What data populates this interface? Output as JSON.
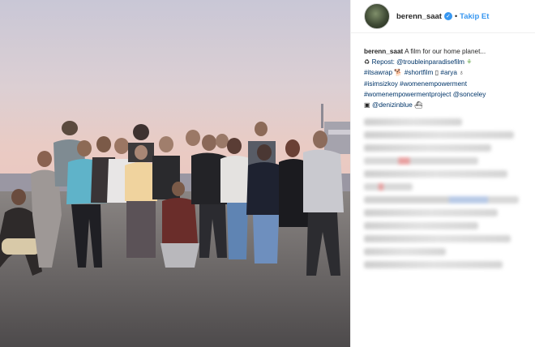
{
  "post": {
    "username": "berenn_saat",
    "follow_label": "Takip Et",
    "separator": "•",
    "caption": {
      "username": "berenn_saat",
      "text": "A film for our home planet...",
      "line2": "Repost: @troubleinparadisefilm",
      "line3a": "#itsawrap",
      "line3b": "#shortfilm",
      "line3c": "#arya",
      "line4a": "#isimsizkoy",
      "line4b": "#womenempowerment",
      "line5a": "#womenempowermentproject",
      "line5b": "@sonceley",
      "line6": "@denizinblue"
    }
  },
  "icons": [
    "verified-badge-icon",
    "recycle-icon",
    "dog-icon",
    "phone-icon",
    "bottle-icon",
    "clapper-icon",
    "ship-icon",
    "plant-icon"
  ]
}
